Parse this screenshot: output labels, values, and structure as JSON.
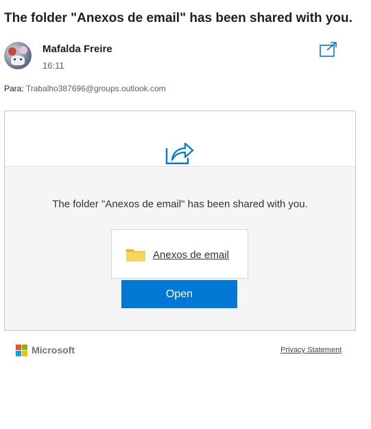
{
  "email": {
    "subject": "The folder \"Anexos de email\" has been shared with you.",
    "sender": "Mafalda Freire",
    "time": "16:11",
    "to_label": "Para:",
    "to_address": "Trabalho387696@groups.outlook.com",
    "popout_icon": "open-in-new-window-icon"
  },
  "card": {
    "share_icon": "share-arrow-icon",
    "message": "The folder \"Anexos de email\" has been shared with you.",
    "folder_icon": "folder-icon",
    "folder_name": "Anexos de email",
    "open_label": "Open"
  },
  "footer": {
    "brand": "Microsoft",
    "privacy_label": "Privacy Statement"
  },
  "colors": {
    "accent": "#0078d4",
    "folder": "#fcd35c",
    "card_bg": "#f5f5f5",
    "ms_red": "#f25022",
    "ms_green": "#7fba00",
    "ms_blue": "#00a4ef",
    "ms_yellow": "#ffb900"
  }
}
